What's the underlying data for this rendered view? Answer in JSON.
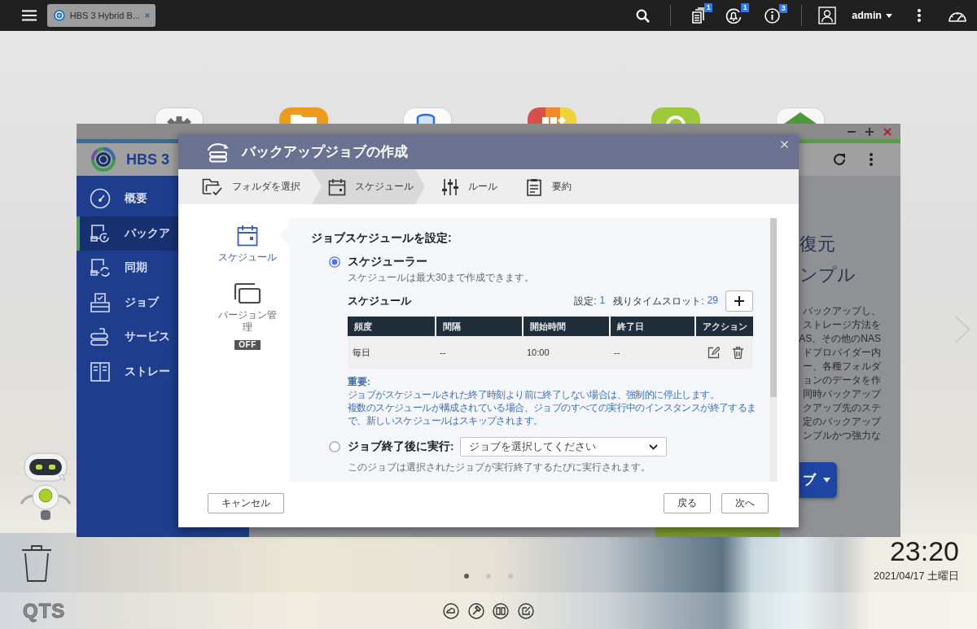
{
  "top_bar": {
    "app_tab": "HBS 3 Hybrid B...",
    "notification_counts": [
      "1",
      "1",
      "3"
    ],
    "user": "admin"
  },
  "desktop": {
    "clock_time": "23:20",
    "clock_date": "2021/04/17 土曜日",
    "pages": [
      {
        "selected": true
      },
      {
        "selected": false
      },
      {
        "selected": false
      }
    ],
    "dock_logo": "QTS"
  },
  "hbs_window": {
    "app_name": "HBS 3",
    "sidebar": [
      {
        "label": "概要",
        "selected": false
      },
      {
        "label": "バックア",
        "selected": true
      },
      {
        "label": "同期",
        "selected": false
      },
      {
        "label": "ジョブ",
        "selected": false
      },
      {
        "label": "サービス",
        "selected": false
      },
      {
        "label": "ストレー",
        "selected": false
      }
    ],
    "headings": [
      "復元",
      "ンプル"
    ],
    "description_lines": [
      "バックアップし、",
      "ストレージ方法を",
      "AS、その他のNAS",
      "ドプロバイダー内",
      "ー、各種フォルダ",
      "ョンのデータを作",
      "同時バックアップ",
      "クアップ先のステ",
      "定のバックアップ",
      "ンプルかつ強力な"
    ],
    "menu_button": "ブ"
  },
  "dialog": {
    "title": "バックアップジョブの作成",
    "steps": [
      {
        "label": "フォルダを選択",
        "selected": false
      },
      {
        "label": "スケジュール",
        "selected": true
      },
      {
        "label": "ルール",
        "selected": false
      },
      {
        "label": "要約",
        "selected": false
      }
    ],
    "side_nav": [
      {
        "label": "スケジュール",
        "selected": true
      },
      {
        "label": "バージョン管理",
        "selected": false,
        "badge": "OFF"
      }
    ],
    "section_title": "ジョブスケジュールを設定:",
    "scheduler": {
      "label": "スケジューラー",
      "selected": true,
      "hint": "スケジュールは最大30まで作成できます。",
      "table_title": "スケジュール",
      "stats": [
        {
          "label": "設定:",
          "value": "1"
        },
        {
          "label": "残りタイムスロット:",
          "value": "29"
        }
      ],
      "columns": [
        "頻度",
        "間隔",
        "開始時間",
        "終了日",
        "アクション"
      ],
      "rows": [
        [
          "毎日",
          "--",
          "10:00",
          "--"
        ]
      ],
      "notice_title": "重要:",
      "notices": [
        "ジョブがスケジュールされた終了時刻より前に終了しない場合は、強制的に停止します。",
        "複数のスケジュールが構成されている場合、ジョブのすべての実行中のインスタンスが終了するまで、新しいスケジュールはスキップされます。"
      ]
    },
    "after_job": {
      "label": "ジョブ終了後に実行:",
      "selected": false,
      "dropdown": "ジョブを選択してください",
      "hint": "このジョブは選択されたジョブが実行終了するたびに実行されます。"
    },
    "buttons": {
      "cancel": "キャンセル",
      "back": "戻る",
      "next": "次へ"
    }
  }
}
